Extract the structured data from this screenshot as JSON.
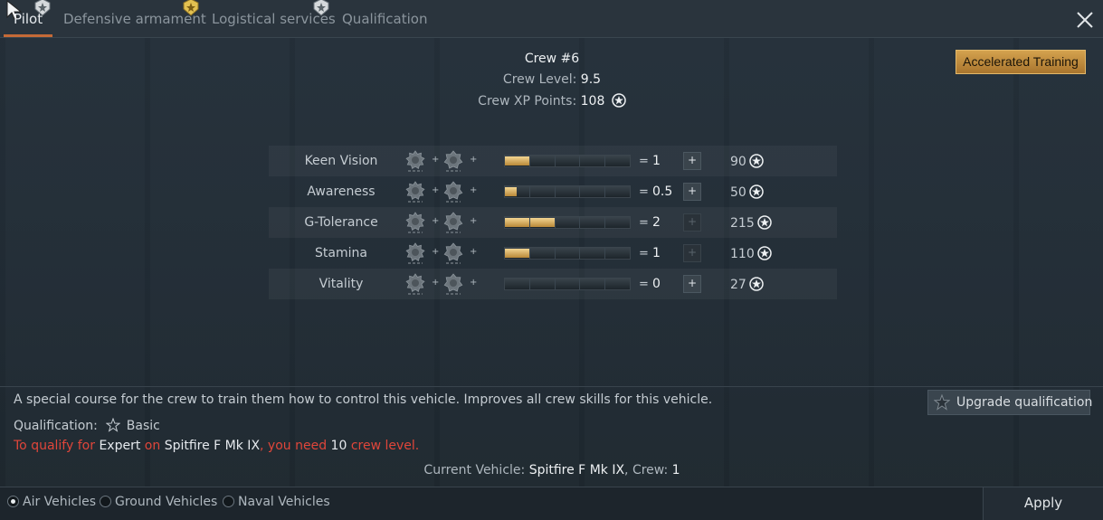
{
  "tabs": [
    {
      "label": "Pilot",
      "active": true
    },
    {
      "label": "Defensive armament",
      "active": false
    },
    {
      "label": "Logistical services",
      "active": false
    },
    {
      "label": "Qualification",
      "active": false
    }
  ],
  "crew": {
    "title": "Crew #6",
    "level_label": "Crew Level:",
    "level_value": "9.5",
    "xp_label": "Crew XP Points:",
    "xp_value": "108"
  },
  "accelerated_training_label": "Accelerated Training",
  "skills": [
    {
      "name": "Keen Vision",
      "value": "1",
      "progress": 0.2,
      "cost": "90",
      "can_increase": true
    },
    {
      "name": "Awareness",
      "value": "0.5",
      "progress": 0.1,
      "cost": "50",
      "can_increase": true
    },
    {
      "name": "G-Tolerance",
      "value": "2",
      "progress": 0.4,
      "cost": "215",
      "can_increase": false
    },
    {
      "name": "Stamina",
      "value": "1",
      "progress": 0.2,
      "cost": "110",
      "can_increase": false
    },
    {
      "name": "Vitality",
      "value": "0",
      "progress": 0.0,
      "cost": "27",
      "can_increase": true
    }
  ],
  "skill_symbols": {
    "plus": "+",
    "equals": "=",
    "increase": "+"
  },
  "description": "A special course for the crew to train them how to control this vehicle. Improves all crew skills for this vehicle.",
  "qualification": {
    "label": "Qualification:",
    "value": "Basic"
  },
  "requirement": {
    "p1": "To qualify for",
    "target": "Expert",
    "p2": "on",
    "vehicle": "Spitfire F Mk IX",
    "p3": ", you need",
    "level": "10",
    "p4": "crew level."
  },
  "upgrade_label": "Upgrade qualification",
  "current": {
    "label": "Current Vehicle:",
    "vehicle": "Spitfire F Mk IX",
    "crew_label": ", Crew:",
    "crew": "1"
  },
  "vehicle_filters": [
    {
      "label": "Air Vehicles",
      "selected": true
    },
    {
      "label": "Ground Vehicles",
      "selected": false
    },
    {
      "label": "Naval Vehicles",
      "selected": false
    }
  ],
  "apply_label": "Apply",
  "colors": {
    "accent": "#c56a37",
    "gold": "#d4a24e",
    "warning": "#e0463a"
  },
  "icons": [
    "cursor-icon",
    "rank-badge-icon",
    "close-icon",
    "crew-xp-icon",
    "ace-medal-icon",
    "expert-medal-icon",
    "qualification-star-icon",
    "upgrade-icon"
  ]
}
